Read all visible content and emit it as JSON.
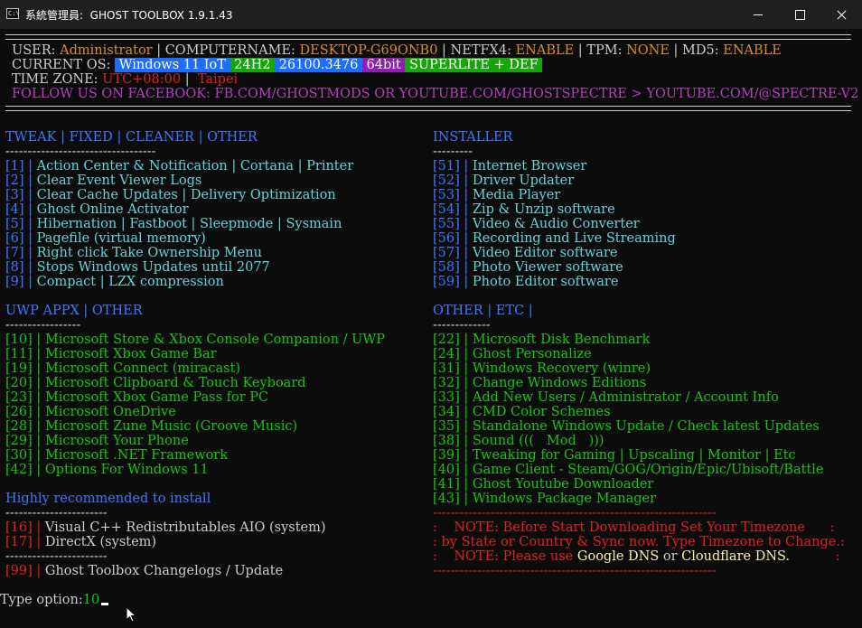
{
  "window": {
    "title": "系統管理員:  GHOST TOOLBOX 1.9.1.43",
    "icon_text": "C:\\"
  },
  "header": {
    "user_label": "USER: ",
    "user": "Administrator",
    "computer_label": " | COMPUTERNAME: ",
    "computer": "DESKTOP-G69ONB0",
    "netfx_label": " | NETFX4: ",
    "netfx": "ENABLE",
    "tpm_label": " | TPM: ",
    "tpm": "NONE",
    "md5_label": " | MD5: ",
    "md5": "ENABLE",
    "os_label": "CURRENT OS: ",
    "os_name": " Windows 11 IoT ",
    "os_ver": " 24H2 ",
    "os_build": " 26100.3476 ",
    "os_arch": " 64bit ",
    "os_edition": " SUPERLITE + DEF ",
    "tz_label": "TIME ZONE: ",
    "tz_offset": "UTC+08:00",
    "tz_sep": " | ",
    "tz_city": " Taipei",
    "follow": "FOLLOW US ON FACEBOOK: FB.COM/GHOSTMODS OR YOUTUBE.COM/GHOSTSPECTRE > YOUTUBE.COM/@SPECTRE-V2"
  },
  "tweak": {
    "heading": "TWEAK | FIXED | CLEANER | OTHER",
    "divider": "----------------------------------",
    "items": [
      {
        "num": "[1]",
        "sep": " | ",
        "label": "Action Center & Notification | Cortana | Printer"
      },
      {
        "num": "[2]",
        "sep": " | ",
        "label": "Clear Event Viewer Logs"
      },
      {
        "num": "[3]",
        "sep": " | ",
        "label": "Clear Cache Updates | Delivery Optimization"
      },
      {
        "num": "[4]",
        "sep": " | ",
        "label": "Ghost Online Activator"
      },
      {
        "num": "[5]",
        "sep": " | ",
        "label": "Hibernation | Fastboot | Sleepmode | Sysmain"
      },
      {
        "num": "[6]",
        "sep": " | ",
        "label": "Pagefile (virtual memory)"
      },
      {
        "num": "[7]",
        "sep": " | ",
        "label": "Right click Take Ownership Menu"
      },
      {
        "num": "[8]",
        "sep": " | ",
        "label": "Stops Windows Updates until 2077"
      },
      {
        "num": "[9]",
        "sep": " | ",
        "label": "Compact | LZX compression"
      }
    ]
  },
  "installer": {
    "heading": "INSTALLER",
    "divider": "---------",
    "items": [
      {
        "num": "[51]",
        "sep": " | ",
        "label": "Internet Browser"
      },
      {
        "num": "[52]",
        "sep": " | ",
        "label": "Driver Updater"
      },
      {
        "num": "[53]",
        "sep": " | ",
        "label": "Media Player"
      },
      {
        "num": "[54]",
        "sep": " | ",
        "label": "Zip & Unzip software"
      },
      {
        "num": "[55]",
        "sep": " | ",
        "label": "Video & Audio Converter"
      },
      {
        "num": "[56]",
        "sep": " | ",
        "label": "Recording and Live Streaming"
      },
      {
        "num": "[57]",
        "sep": " | ",
        "label": "Video Editor software"
      },
      {
        "num": "[58]",
        "sep": " | ",
        "label": "Photo Viewer software"
      },
      {
        "num": "[59]",
        "sep": " | ",
        "label": "Photo Editor software"
      }
    ]
  },
  "uwp": {
    "heading": "UWP APPX | OTHER",
    "divider": "-----------------",
    "items": [
      {
        "num": "[10]",
        "sep": " | ",
        "label": "Microsoft Store & Xbox Console Companion / UWP"
      },
      {
        "num": "[11]",
        "sep": " | ",
        "label": "Microsoft Xbox Game Bar"
      },
      {
        "num": "[19]",
        "sep": " | ",
        "label": "Microsoft Connect (miracast)"
      },
      {
        "num": "[20]",
        "sep": " | ",
        "label": "Microsoft Clipboard & Touch Keyboard"
      },
      {
        "num": "[23]",
        "sep": " | ",
        "label": "Microsoft Xbox Game Pass for PC"
      },
      {
        "num": "[26]",
        "sep": " | ",
        "label": "Microsoft OneDrive"
      },
      {
        "num": "[28]",
        "sep": " | ",
        "label": "Microsoft Zune Music (Groove Music)"
      },
      {
        "num": "[29]",
        "sep": " | ",
        "label": "Microsoft Your Phone"
      },
      {
        "num": "[30]",
        "sep": " | ",
        "label": "Microsoft .NET Framework"
      },
      {
        "num": "[42]",
        "sep": " | ",
        "label": "Options For Windows 11"
      }
    ]
  },
  "other": {
    "heading": "OTHER | ETC |",
    "divider": "-------------",
    "items": [
      {
        "num": "[22]",
        "sep": " | ",
        "label": "Microsoft Disk Benchmark"
      },
      {
        "num": "[24]",
        "sep": " | ",
        "label": "Ghost Personalize"
      },
      {
        "num": "[31]",
        "sep": " | ",
        "label": "Windows Recovery (winre)"
      },
      {
        "num": "[32]",
        "sep": " | ",
        "label": "Change Windows Editions"
      },
      {
        "num": "[33]",
        "sep": " | ",
        "label": "Add New Users / Administrator / Account Info"
      },
      {
        "num": "[34]",
        "sep": " | ",
        "label": "CMD Color Schemes"
      },
      {
        "num": "[35]",
        "sep": " | ",
        "label": "Standalone Windows Update / Check latest Updates"
      },
      {
        "num": "[38]",
        "sep": " | ",
        "label": "Sound (((   Mod   )))"
      },
      {
        "num": "[39]",
        "sep": " | ",
        "label": "Tweaking for Gaming | Upscaling | Monitor | Etc"
      },
      {
        "num": "[40]",
        "sep": " | ",
        "label": "Game Client - Steam/GOG/Origin/Epic/Ubisoft/Battle"
      },
      {
        "num": "[41]",
        "sep": " | ",
        "label": "Ghost Youtube Downloader"
      },
      {
        "num": "[43]",
        "sep": " | ",
        "label": "Windows Package Manager"
      }
    ]
  },
  "recommended": {
    "heading": "Highly recommended to install",
    "divider": "-----------------------",
    "items": [
      {
        "num": "[16]",
        "sep": " | ",
        "label": "Visual C++ Redistributables AIO (system)"
      },
      {
        "num": "[17]",
        "sep": " | ",
        "label": "DirectX (system)"
      }
    ],
    "divider2": "-----------------------",
    "changelog": {
      "num": "[99]",
      "sep": " | ",
      "label": "Ghost Toolbox Changelogs / Update"
    }
  },
  "note": {
    "dash_top": "----------------------------------------------------------------",
    "line1": ":    NOTE: Before Start Downloading Set Your Timezone      :",
    "line2": ": by State or Country & Sync now. Type Timezone to Change.:",
    "line3_a": ":    NOTE: Please use ",
    "line3_google": "Google DNS",
    "line3_or": " or ",
    "line3_cloud": "Cloudflare DNS.",
    "line3_end": "           :",
    "dash_bottom": "----------------------------------------------------------------"
  },
  "prompt": {
    "label": "Type option:",
    "value": "10"
  },
  "colors": {
    "background": "#0c0c0c",
    "text": "#cccccc",
    "orange": "#d98c2b",
    "magenta": "#b53fbf",
    "red": "#e02020",
    "blue": "#3b78ff",
    "green": "#16c60c",
    "cyan": "#61d6d6",
    "yellow": "#f9f1a5"
  }
}
